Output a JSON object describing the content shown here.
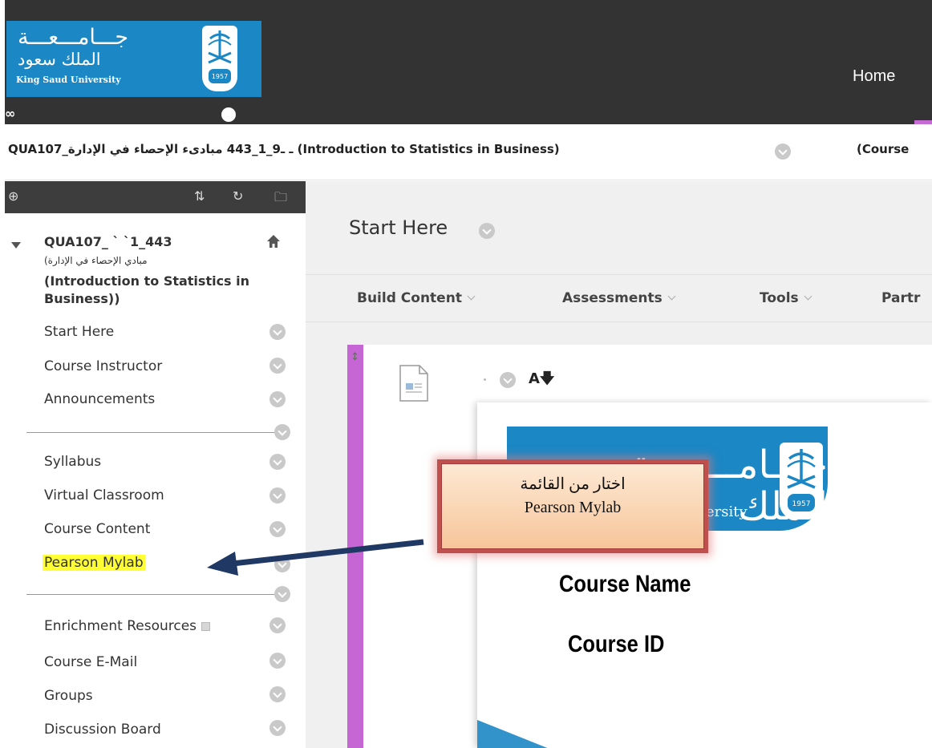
{
  "header": {
    "logo": {
      "arabic_line1": "جـــامـــعـــة",
      "arabic_line2": "الملك سعود",
      "english": "King Saud University",
      "emblem_year": "1957"
    },
    "nav": {
      "home_label": "Home"
    }
  },
  "breadcrumb": {
    "course_title": "QUA107_ـ ـ9_1_443 مبادىء الإحصاء في الإدارة (Introduction to Statistics in Business)",
    "next_label": "(Course"
  },
  "sidebar": {
    "course": {
      "code": "QUA107_   ` `1_443",
      "arabic_name": "مبادي  الإحصاء في الإدارة)",
      "english_name": "(Introduction to Statistics in Business))"
    },
    "items": [
      {
        "label": "Start Here"
      },
      {
        "label": "Course Instructor"
      },
      {
        "label": "Announcements"
      },
      {
        "label": "Syllabus"
      },
      {
        "label": "Virtual Classroom"
      },
      {
        "label": "Course Content"
      },
      {
        "label": "Pearson Mylab"
      },
      {
        "label": "Enrichment Resources"
      },
      {
        "label": "Course E-Mail"
      },
      {
        "label": "Groups"
      },
      {
        "label": "Discussion Board"
      }
    ]
  },
  "content": {
    "page_title": "Start Here",
    "actions": [
      {
        "label": "Build Content"
      },
      {
        "label": "Assessments"
      },
      {
        "label": "Tools"
      },
      {
        "label": "Partr"
      }
    ],
    "item": {
      "slide": {
        "arabic_logo": "جـــامـــعـــة الملك",
        "english_logo": "ersity",
        "emblem_year": "1957",
        "course_name": "Course Name",
        "course_id": "Course ID"
      }
    }
  },
  "callout": {
    "line1": "اختار من القائمة",
    "line2": "Pearson Mylab"
  },
  "colors": {
    "header_bg": "#333333",
    "brand_blue": "#1b87c4",
    "accent_purple": "#c566d4",
    "highlight_yellow": "#ffff33",
    "callout_border": "#c0504d",
    "arrow": "#203864"
  }
}
